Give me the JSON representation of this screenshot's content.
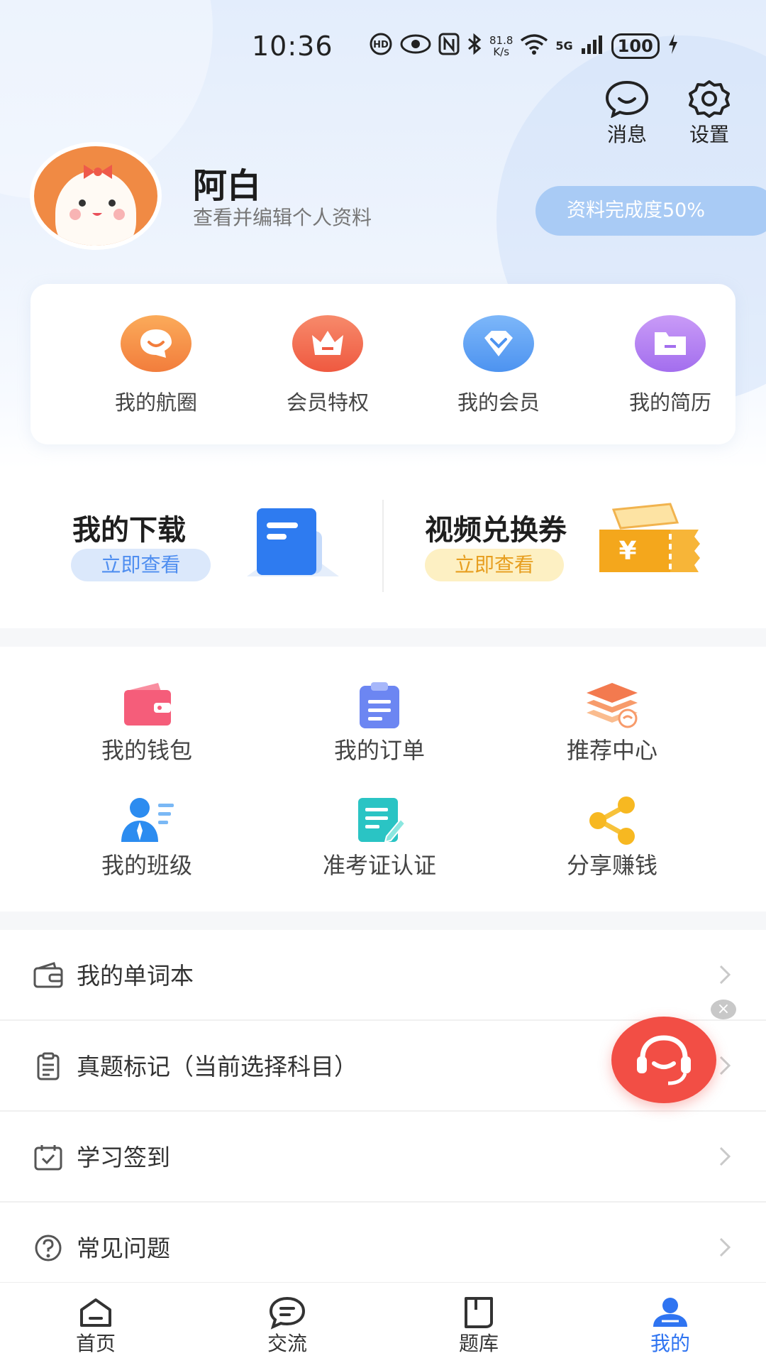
{
  "status_bar": {
    "time": "10:36",
    "net_speed_value": "81.8",
    "net_speed_unit": "K/s",
    "network": "5G",
    "battery": "100"
  },
  "topbar": {
    "message_label": "消息",
    "settings_label": "设置"
  },
  "profile": {
    "name": "阿白",
    "subtitle": "查看并编辑个人资料",
    "completion": "资料完成度50%"
  },
  "quick_card": [
    {
      "label": "我的航圈",
      "color": "#f79a4b"
    },
    {
      "label": "会员特权",
      "color": "#f2684f"
    },
    {
      "label": "我的会员",
      "color": "#5ba3f4"
    },
    {
      "label": "我的简历",
      "color": "#b27af0"
    }
  ],
  "downloads": {
    "title": "我的下载",
    "action": "立即查看"
  },
  "voucher": {
    "title": "视频兑换券",
    "action": "立即查看"
  },
  "grid": [
    {
      "label": "我的钱包"
    },
    {
      "label": "我的订单"
    },
    {
      "label": "推荐中心"
    },
    {
      "label": "我的班级"
    },
    {
      "label": "准考证认证"
    },
    {
      "label": "分享赚钱"
    }
  ],
  "list": [
    {
      "label": "我的单词本"
    },
    {
      "label": "真题标记（当前选择科目）"
    },
    {
      "label": "学习签到"
    },
    {
      "label": "常见问题"
    }
  ],
  "nav": [
    {
      "label": "首页"
    },
    {
      "label": "交流"
    },
    {
      "label": "题库"
    },
    {
      "label": "我的"
    }
  ],
  "colors": {
    "accent": "#2f74f1",
    "float": "#f24e45"
  }
}
